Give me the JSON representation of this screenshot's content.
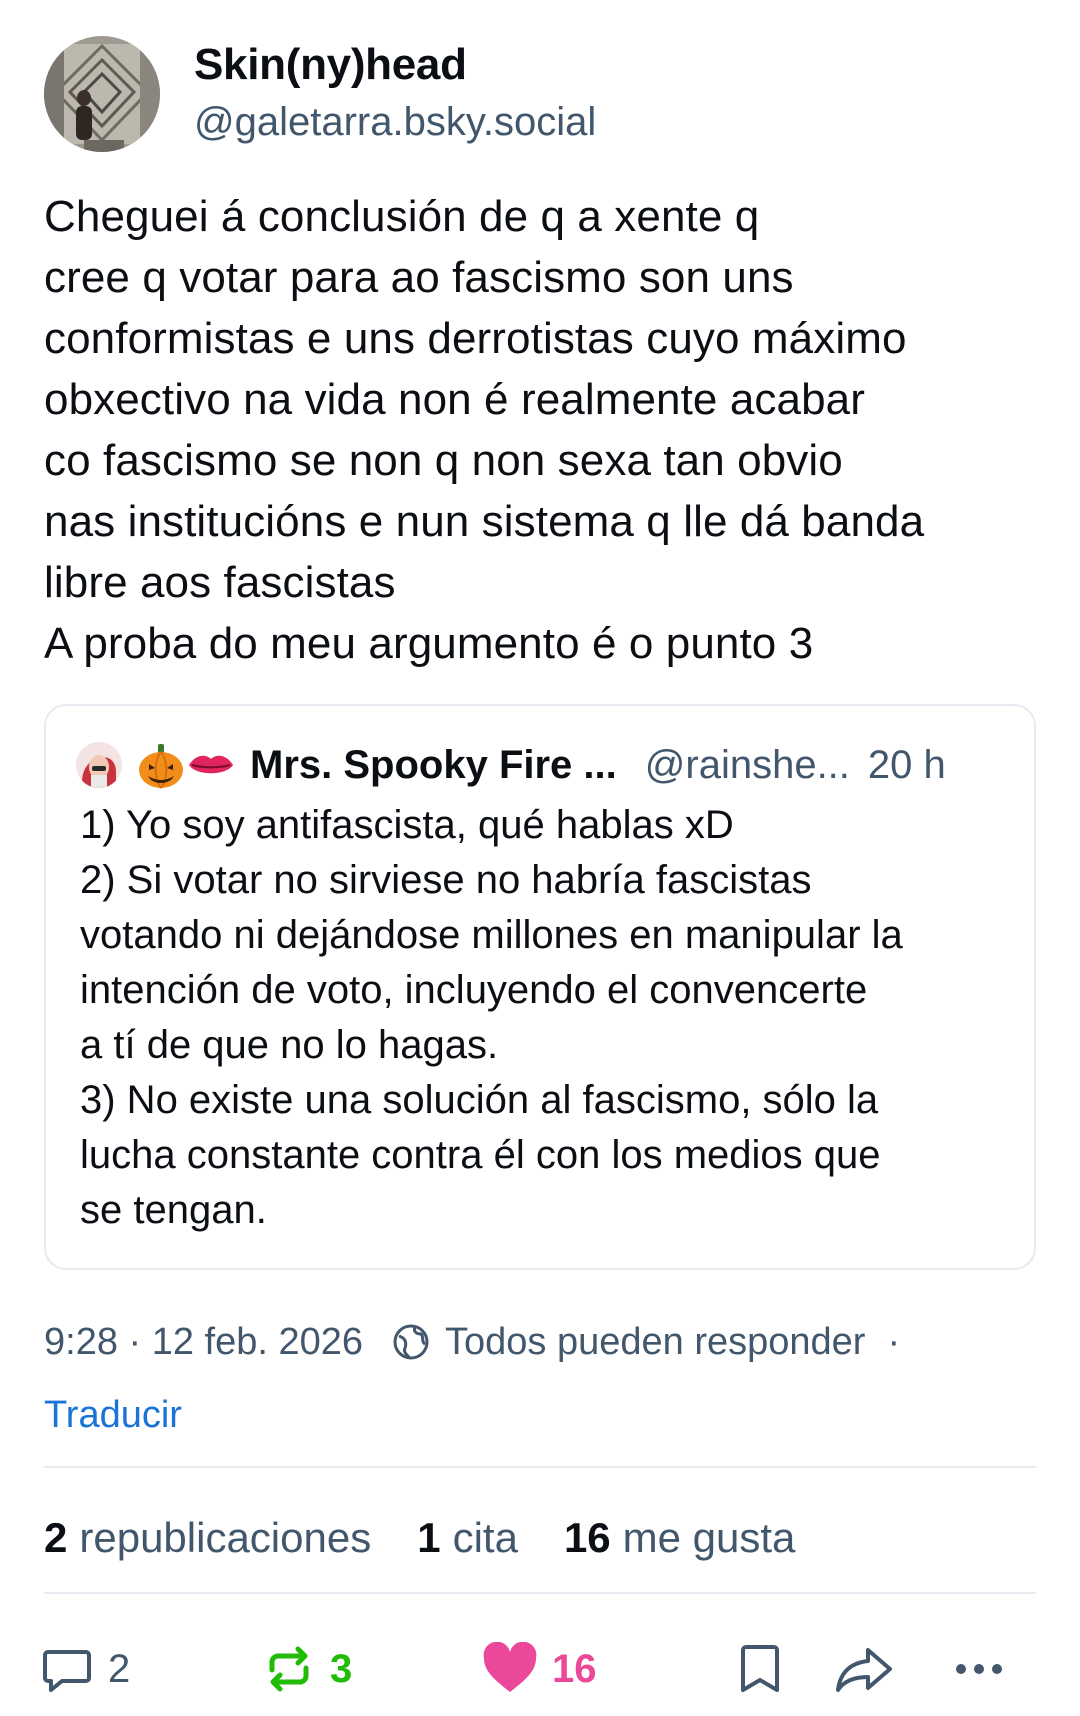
{
  "author": {
    "display_name": "Skin(ny)head",
    "handle": "@galetarra.bsky.social"
  },
  "post": {
    "text": "Cheguei á conclusión de q a xente q\ncree q votar para ao fascismo son uns\nconformistas e uns derrotistas cuyo máximo\nobxectivo na vida non é realmente acabar\nco fascismo se non q non sexa tan obvio\nnas institucións e nun sistema q lle dá banda\nlibre aos fascistas\nA proba do meu argumento é o punto 3"
  },
  "quote": {
    "display_name": "Mrs. Spooky Fire ...",
    "handle": "@rainshe...",
    "time": "20 h",
    "text": "1) Yo soy antifascista, qué hablas xD\n2) Si votar no sirviese no habría fascistas\nvotando ni dejándose millones en manipular la\nintención de voto, incluyendo el convencerte\na tí de que no lo hagas.\n3) No existe una solución al fascismo, sólo la\nlucha constante contra él con los medios que\nse tengan.",
    "emojis": [
      "pumpkin-emoji",
      "lips-emoji"
    ]
  },
  "meta": {
    "timestamp": "9:28 · 12 feb. 2026",
    "reply_setting": "Todos pueden responder",
    "separator": "·",
    "translate": "Traducir"
  },
  "stats": {
    "reposts_count": "2",
    "reposts_label": "republicaciones",
    "quotes_count": "1",
    "quotes_label": "cita",
    "likes_count": "16",
    "likes_label": "me gusta"
  },
  "actions": {
    "reply_count": "2",
    "repost_count": "3",
    "like_count": "16",
    "icons": [
      "reply-icon",
      "repost-icon",
      "heart-icon",
      "bookmark-icon",
      "share-icon",
      "more-icon"
    ]
  },
  "colors": {
    "text": "#0b0f14",
    "muted": "#42576c",
    "link": "#1a74d6",
    "repost_green": "#20bc07",
    "like_pink": "#ec4899",
    "border": "#e5ebf0"
  }
}
